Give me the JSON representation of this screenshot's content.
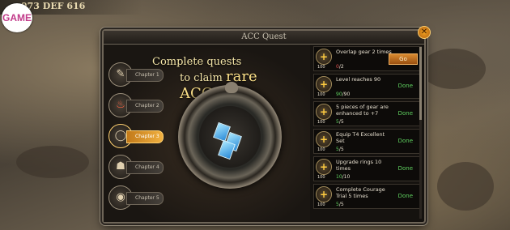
{
  "hud": {
    "stats": "973 DEF 616"
  },
  "watermark_logo": {
    "text": "GAME"
  },
  "window": {
    "title": "ACC Quest"
  },
  "headline": {
    "line1": "Complete quests",
    "line2_prefix": "to claim ",
    "line2_big": "rare ACCs"
  },
  "chapters": [
    {
      "label": "Chapter 1",
      "icon": "pen-icon"
    },
    {
      "label": "Chapter 2",
      "icon": "flame-icon"
    },
    {
      "label": "Chapter 3",
      "icon": "ring-icon",
      "active": true
    },
    {
      "label": "Chapter 4",
      "icon": "helmet-icon"
    },
    {
      "label": "Chapter 5",
      "icon": "orb-icon"
    }
  ],
  "quests": [
    {
      "desc": "Overlap gear 2 times",
      "current": "0",
      "total": "/2",
      "reward": "100",
      "action": "Go"
    },
    {
      "desc": "Level reaches 90",
      "current": "90",
      "total": "/90",
      "reward": "100",
      "action": "Done"
    },
    {
      "desc": "5 pieces of gear are enhanced to +7",
      "current": "5",
      "total": "/5",
      "reward": "100",
      "action": "Done"
    },
    {
      "desc": "Equip T4 Excellent Set",
      "current": "5",
      "total": "/5",
      "reward": "100",
      "action": "Done"
    },
    {
      "desc": "Upgrade rings 10 times",
      "current": "10",
      "total": "/10",
      "reward": "100",
      "action": "Done"
    },
    {
      "desc": "Complete Courage Trial 5 times",
      "current": "5",
      "total": "/5",
      "reward": "100",
      "action": "Done"
    }
  ],
  "colors": {
    "done": "#5fd05f",
    "gold": "#ffe38a",
    "button": "#d88a30"
  }
}
